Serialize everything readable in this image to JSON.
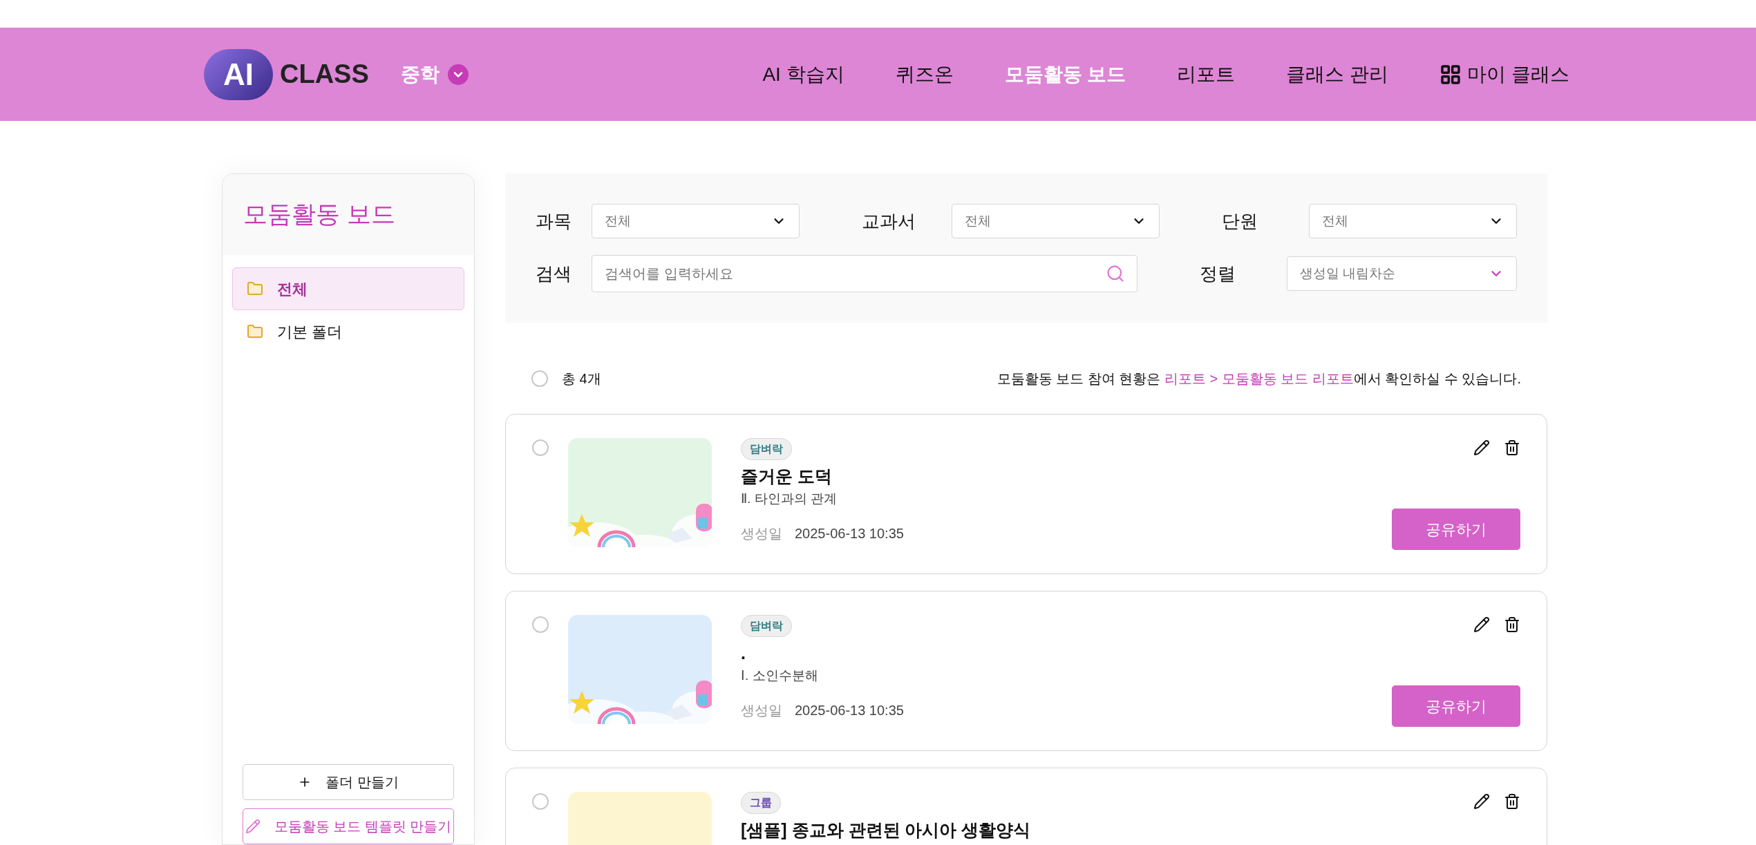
{
  "header": {
    "logo": {
      "mark": "AI",
      "word": "CLASS"
    },
    "school_level": "중학",
    "nav": [
      {
        "label": "AI 학습지",
        "selected": false
      },
      {
        "label": "퀴즈온",
        "selected": false
      },
      {
        "label": "모둠활동 보드",
        "selected": true
      },
      {
        "label": "리포트",
        "selected": false
      },
      {
        "label": "클래스 관리",
        "selected": false
      },
      {
        "label": "마이 클래스",
        "selected": false,
        "kind": "icon"
      }
    ]
  },
  "sidebar": {
    "title": "모둠활동 보드",
    "folders": [
      {
        "label": "전체",
        "selected": true
      },
      {
        "label": "기본 폴더",
        "selected": false
      }
    ],
    "buttons": [
      {
        "label": "폴더 만들기",
        "kind": "plus"
      },
      {
        "label": "모둠활동 보드 템플릿 만들기",
        "kind": "pencil"
      }
    ]
  },
  "filters": {
    "subject": {
      "label": "과목",
      "value": "전체"
    },
    "textbook": {
      "label": "교과서",
      "value": "전체"
    },
    "unit": {
      "label": "단원",
      "value": "전체"
    },
    "search": {
      "label": "검색",
      "placeholder": "검색어를 입력하세요"
    },
    "sort": {
      "label": "정렬",
      "value": "생성일 내림차순"
    }
  },
  "summary": {
    "select_all_checked": false,
    "total": "총 4개",
    "notice_before": "모둠활동 보드 참여 현황은 ",
    "notice_link": "리포트 > 모둠활동 보드 리포트",
    "notice_after": "에서 확인하실 수 있습니다."
  },
  "boards": [
    {
      "checked": false,
      "tag": "담벼락",
      "color": "#2f7f86",
      "title": "즐거운 도덕",
      "unit": "Ⅱ. 타인과의 관계",
      "date_label": "생성일",
      "date": "2025-06-13 10:35",
      "share": "공유하기"
    },
    {
      "checked": false,
      "tag": "담벼락",
      "color": "#2f7f86",
      "title": ".",
      "unit": "Ⅰ. 소인수분해",
      "date_label": "생성일",
      "date": "2025-06-13 10:35",
      "share": "공유하기"
    },
    {
      "checked": false,
      "tag": "그룹",
      "color": "#6a4bb0",
      "title": "[샘플] 종교와 관련된 아시아 생활양식"
    }
  ]
}
